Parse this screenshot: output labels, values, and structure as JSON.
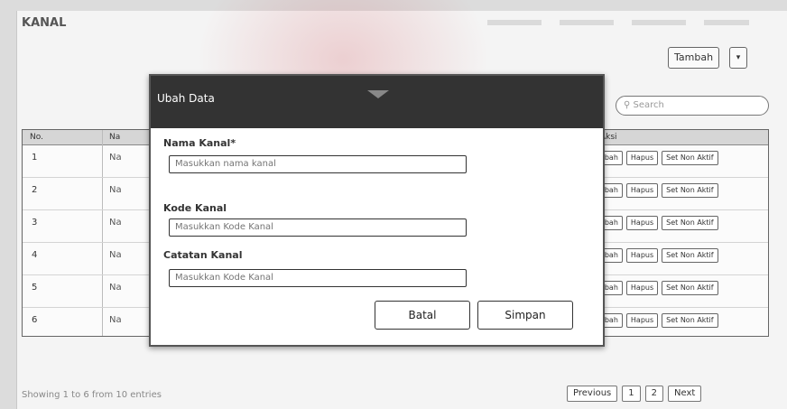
{
  "page": {
    "title": "KANAL",
    "add_button": "Tambah",
    "search_placeholder": "Search"
  },
  "table": {
    "headers": [
      "No.",
      "Na",
      "Aksi"
    ],
    "rows": [
      {
        "no": "1",
        "name": "Na"
      },
      {
        "no": "2",
        "name": "Na"
      },
      {
        "no": "3",
        "name": "Na"
      },
      {
        "no": "4",
        "name": "Na"
      },
      {
        "no": "5",
        "name": "Na"
      },
      {
        "no": "6",
        "name": "Na"
      }
    ],
    "actions": {
      "edit": "Ubah",
      "delete": "Hapus",
      "deactivate": "Set Non Aktif"
    }
  },
  "footer": {
    "info": "Showing 1 to 6 from 10 entries",
    "pager": [
      "Previous",
      "1",
      "2",
      "Next"
    ]
  },
  "modal": {
    "title": "Ubah Data",
    "fields": [
      {
        "label": "Nama Kanal*",
        "placeholder": "Masukkan nama kanal"
      },
      {
        "label": "Kode Kanal",
        "placeholder": "Masukkan Kode Kanal"
      },
      {
        "label": "Catatan Kanal",
        "placeholder": "Masukkan Kode Kanal"
      }
    ],
    "cancel": "Batal",
    "save": "Simpan"
  }
}
